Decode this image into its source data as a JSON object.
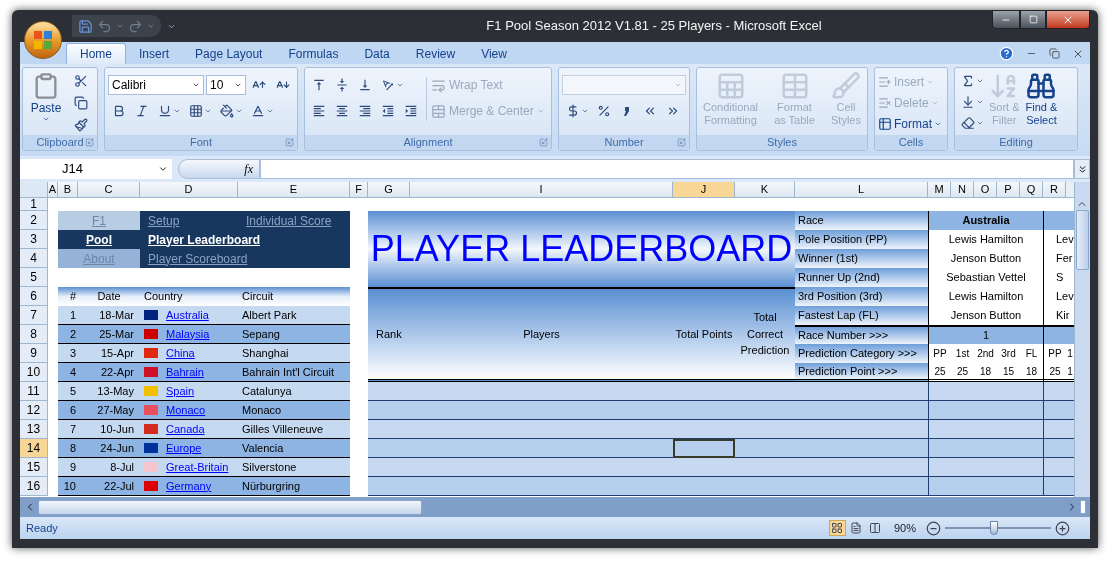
{
  "window": {
    "title": "F1 Pool Season 2012 V1.81 - 25 Players - Microsoft Excel"
  },
  "ribbon_tabs": [
    {
      "label": "Home",
      "selected": true
    },
    {
      "label": "Insert",
      "selected": false
    },
    {
      "label": "Page Layout",
      "selected": false
    },
    {
      "label": "Formulas",
      "selected": false
    },
    {
      "label": "Data",
      "selected": false
    },
    {
      "label": "Review",
      "selected": false
    },
    {
      "label": "View",
      "selected": false
    }
  ],
  "ribbon": {
    "clipboard": {
      "label": "Clipboard",
      "paste": "Paste"
    },
    "font": {
      "label": "Font",
      "font_name": "Calibri",
      "font_size": "10"
    },
    "alignment": {
      "label": "Alignment",
      "commands": [
        {
          "label": "Wrap Text",
          "disabled": true
        },
        {
          "label": "Merge & Center",
          "disabled": true
        }
      ]
    },
    "number": {
      "label": "Number"
    },
    "styles": {
      "label": "Styles",
      "commands": [
        {
          "lines": [
            "Conditional",
            "Formatting"
          ],
          "disabled": true
        },
        {
          "lines": [
            "Format",
            "as Table"
          ],
          "disabled": true
        },
        {
          "lines": [
            "Cell",
            "Styles"
          ],
          "disabled": true
        }
      ]
    },
    "cells": {
      "label": "Cells",
      "commands": [
        {
          "label": "Insert",
          "disabled": true
        },
        {
          "label": "Delete",
          "disabled": true
        },
        {
          "label": "Format",
          "disabled": false
        }
      ]
    },
    "editing": {
      "label": "Editing",
      "commands": [
        {
          "lines": [
            "Sort &",
            "Filter"
          ],
          "disabled": true
        },
        {
          "lines": [
            "Find &",
            "Select"
          ],
          "disabled": false
        }
      ]
    }
  },
  "formula_bar": {
    "name_box": "J14",
    "function_label": "fx"
  },
  "sheet": {
    "columns": [
      {
        "label": "A",
        "selected": false
      },
      {
        "label": "B",
        "selected": false
      },
      {
        "label": "C",
        "selected": false
      },
      {
        "label": "D",
        "selected": false
      },
      {
        "label": "E",
        "selected": false
      },
      {
        "label": "F",
        "selected": false
      },
      {
        "label": "G",
        "selected": false
      },
      {
        "label": "I",
        "selected": false
      },
      {
        "label": "J",
        "selected": true
      },
      {
        "label": "K",
        "selected": false
      },
      {
        "label": "L",
        "selected": false
      },
      {
        "label": "M",
        "selected": false
      },
      {
        "label": "N",
        "selected": false
      },
      {
        "label": "O",
        "selected": false
      },
      {
        "label": "P",
        "selected": false
      },
      {
        "label": "Q",
        "selected": false
      },
      {
        "label": "R",
        "selected": false
      }
    ],
    "rows": [
      {
        "label": "1",
        "selected": false
      },
      {
        "label": "2",
        "selected": false
      },
      {
        "label": "3",
        "selected": false
      },
      {
        "label": "4",
        "selected": false
      },
      {
        "label": "5",
        "selected": false
      },
      {
        "label": "6",
        "selected": false
      },
      {
        "label": "7",
        "selected": false
      },
      {
        "label": "8",
        "selected": false
      },
      {
        "label": "9",
        "selected": false
      },
      {
        "label": "10",
        "selected": false
      },
      {
        "label": "11",
        "selected": false
      },
      {
        "label": "12",
        "selected": false
      },
      {
        "label": "13",
        "selected": false
      },
      {
        "label": "14",
        "selected": true
      },
      {
        "label": "15",
        "selected": false
      },
      {
        "label": "16",
        "selected": false
      }
    ]
  },
  "navigation": {
    "left": [
      {
        "label": "F1",
        "selected": false,
        "color": "#b8cce4"
      },
      {
        "label": "Pool",
        "selected": true,
        "color": "#17375e"
      },
      {
        "label": "About",
        "selected": false,
        "color": "#95b3d7"
      }
    ],
    "right": [
      {
        "items": [
          {
            "label": "Setup",
            "selected": false
          },
          {
            "label": "Individual Score",
            "selected": false
          }
        ]
      },
      {
        "items": [
          {
            "label": "Player Leaderboard",
            "selected": true
          }
        ]
      },
      {
        "items": [
          {
            "label": "Player Scoreboard",
            "selected": false
          }
        ]
      }
    ]
  },
  "races": {
    "columns": [
      "#",
      "Date",
      "Country",
      "Circuit"
    ],
    "rows": [
      {
        "number": "1",
        "date": "18-Mar",
        "country": "Australia",
        "circuit": "Albert Park",
        "color": "#00247d"
      },
      {
        "number": "2",
        "date": "25-Mar",
        "country": "Malaysia",
        "circuit": "Sepang",
        "color": "#cc0001"
      },
      {
        "number": "3",
        "date": "15-Apr",
        "country": "China",
        "circuit": "Shanghai",
        "color": "#de2910"
      },
      {
        "number": "4",
        "date": "22-Apr",
        "country": "Bahrain",
        "circuit": "Bahrain Int'l Circuit",
        "color": "#ce1126"
      },
      {
        "number": "5",
        "date": "13-May",
        "country": "Spain",
        "circuit": "Catalunya",
        "color": "#f1bf00"
      },
      {
        "number": "6",
        "date": "27-May",
        "country": "Monaco",
        "circuit": "Monaco",
        "color": "#e8505f"
      },
      {
        "number": "7",
        "date": "10-Jun",
        "country": "Canada",
        "circuit": "Gilles Villeneuve",
        "color": "#d52b1e"
      },
      {
        "number": "8",
        "date": "24-Jun",
        "country": "Europe",
        "circuit": "Valencia",
        "color": "#003399"
      },
      {
        "number": "9",
        "date": "8-Jul",
        "country": "Great-Britain",
        "circuit": "Silverstone",
        "color": "#f4c6cc"
      },
      {
        "number": "10",
        "date": "22-Jul",
        "country": "Germany",
        "circuit": "Nürburgring",
        "color": "#dd0000"
      }
    ]
  },
  "leaderboard": {
    "title": "PLAYER LEADERBOARD",
    "columns": [
      "Rank",
      "Players",
      "Total Points",
      "Total Correct Prediction"
    ],
    "race_labels": [
      "Race",
      "Pole Position (PP)",
      "Winner (1st)",
      "Runner Up (2nd)",
      "3rd Position (3rd)",
      "Fastest Lap (FL)",
      "Race Number >>>",
      "Prediction Category >>>",
      "Prediction Point >>>"
    ],
    "races": [
      {
        "name": "Australia",
        "results": [
          "Lewis Hamilton",
          "Jenson Button",
          "Sebastian Vettel",
          "Lewis Hamilton",
          "Jenson Button"
        ],
        "race_number": "1",
        "categories": [
          "PP",
          "1st",
          "2nd",
          "3rd",
          "FL"
        ],
        "points": [
          "25",
          "25",
          "18",
          "15",
          "18"
        ]
      },
      {
        "results": [
          "Lev",
          "Fer",
          "S",
          "Lev",
          "Kir"
        ],
        "categories": [
          "PP",
          "1"
        ],
        "points": [
          "25",
          "1"
        ]
      }
    ]
  },
  "status_bar": {
    "text": "Ready",
    "views": [
      {
        "kind": "normal",
        "selected": true
      },
      {
        "kind": "page-layout",
        "selected": false
      },
      {
        "kind": "page-break",
        "selected": false
      }
    ],
    "zoom": "90%",
    "zoom_slider": {
      "level": 0.46
    }
  }
}
